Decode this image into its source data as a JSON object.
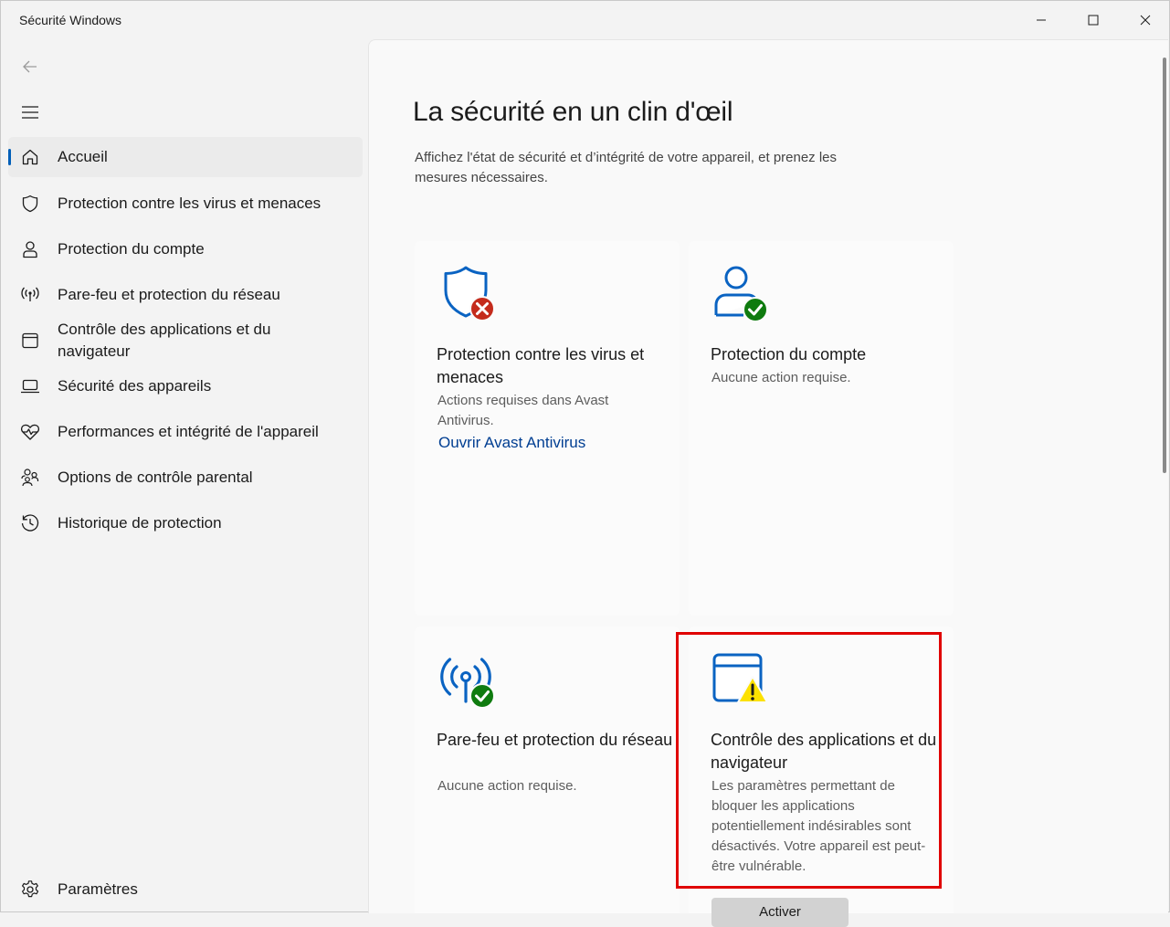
{
  "window": {
    "title": "Sécurité Windows"
  },
  "sidebar": {
    "items": [
      {
        "label": "Accueil",
        "icon": "home-icon",
        "active": true
      },
      {
        "label": "Protection contre les virus et menaces",
        "icon": "shield-icon"
      },
      {
        "label": "Protection du compte",
        "icon": "person-icon"
      },
      {
        "label": "Pare-feu et protection du réseau",
        "icon": "wifi-antenna-icon"
      },
      {
        "label": "Contrôle des applications et du navigateur",
        "icon": "browser-window-icon"
      },
      {
        "label": "Sécurité des appareils",
        "icon": "laptop-icon"
      },
      {
        "label": "Performances et intégrité de l'appareil",
        "icon": "heart-pulse-icon"
      },
      {
        "label": "Options de contrôle parental",
        "icon": "family-icon"
      },
      {
        "label": "Historique de protection",
        "icon": "history-icon"
      }
    ],
    "settings_label": "Paramètres"
  },
  "main": {
    "title": "La sécurité en un clin d'œil",
    "description": "Affichez l'état de sécurité et d’intégrité de votre appareil, et prenez les mesures nécessaires.",
    "cards": [
      {
        "title": "Protection contre les virus et menaces",
        "status": "Actions requises dans Avast Antivirus.",
        "link": "Ouvrir Avast Antivirus",
        "icon": "shield-error-icon",
        "state": "error"
      },
      {
        "title": "Protection du compte",
        "status": "Aucune action requise.",
        "icon": "account-ok-icon",
        "state": "ok"
      },
      {
        "title": "Pare-feu et protection du réseau",
        "status": "Aucune action requise.",
        "icon": "firewall-ok-icon",
        "state": "ok"
      },
      {
        "title": "Contrôle des applications et du navigateur",
        "status": "Les paramètres permettant de bloquer les applications potentiellement indésirables sont désactivés. Votre appareil est peut-être vulnérable.",
        "icon": "app-browser-warning-icon",
        "state": "warning",
        "action_label": "Activer"
      }
    ]
  },
  "colors": {
    "accent": "#005fb8",
    "error": "#c42b1c",
    "success": "#0f7b0f",
    "warning": "#fce100",
    "highlight": "#e00000",
    "link": "#003e92"
  }
}
